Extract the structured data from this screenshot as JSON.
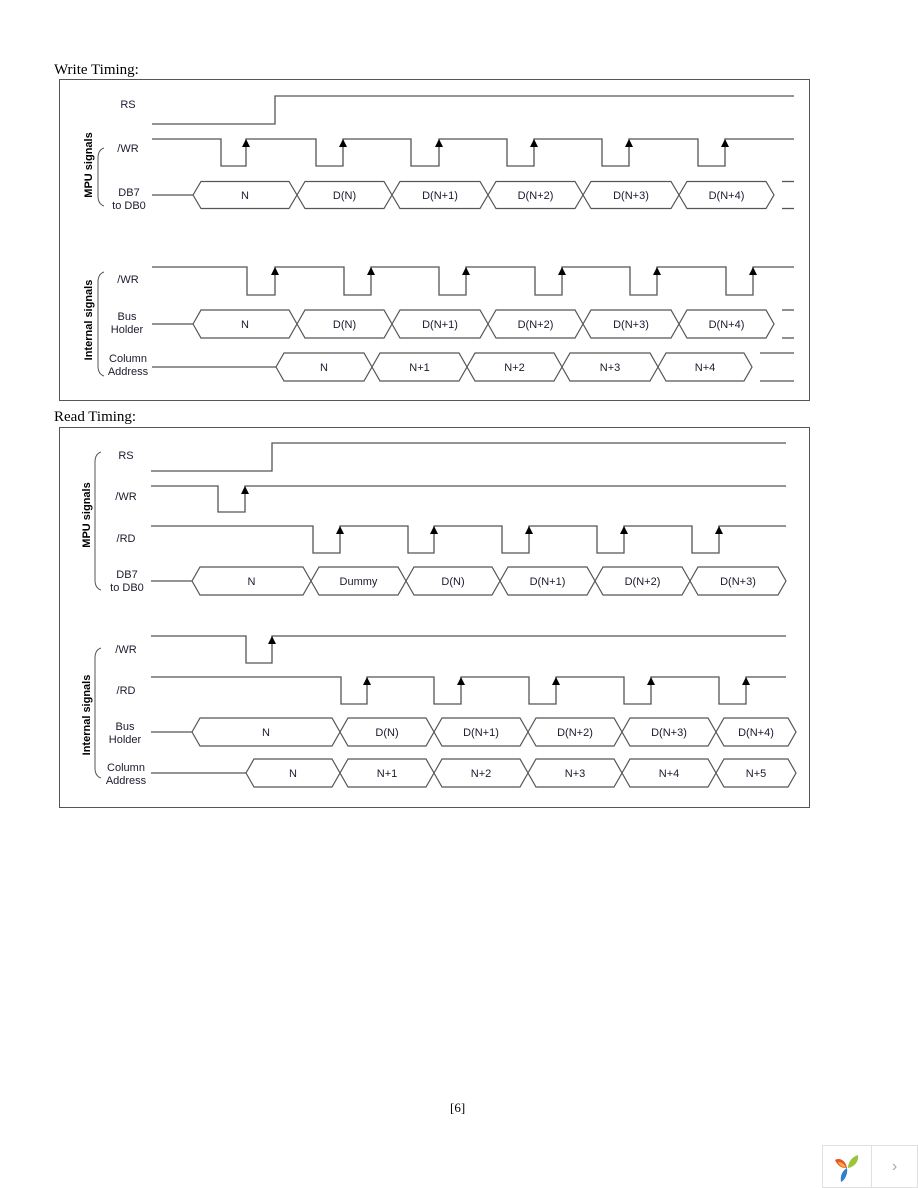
{
  "sections": {
    "write": {
      "title": "Write Timing:",
      "groups": [
        {
          "label": "MPU signals"
        },
        {
          "label": "Internal signals"
        }
      ],
      "signals": {
        "rs": {
          "label": "RS"
        },
        "wr": {
          "label": "/WR"
        },
        "db": {
          "label_line1": "DB7",
          "label_line2": "to DB0"
        },
        "int_wr": {
          "label": "/WR"
        },
        "bus": {
          "label_line1": "Bus",
          "label_line2": "Holder"
        },
        "col": {
          "label_line1": "Column",
          "label_line2": "Address"
        }
      },
      "db_values": [
        "N",
        "D(N)",
        "D(N+1)",
        "D(N+2)",
        "D(N+3)",
        "D(N+4)"
      ],
      "bus_values": [
        "N",
        "D(N)",
        "D(N+1)",
        "D(N+2)",
        "D(N+3)",
        "D(N+4)"
      ],
      "col_values": [
        "N",
        "N+1",
        "N+2",
        "N+3",
        "N+4"
      ]
    },
    "read": {
      "title": "Read Timing:",
      "groups": [
        {
          "label": "MPU signals"
        },
        {
          "label": "Internal signals"
        }
      ],
      "signals": {
        "rs": {
          "label": "RS"
        },
        "wr": {
          "label": "/WR"
        },
        "rd": {
          "label": "/RD"
        },
        "db": {
          "label_line1": "DB7",
          "label_line2": "to DB0"
        },
        "int_wr": {
          "label": "/WR"
        },
        "int_rd": {
          "label": "/RD"
        },
        "bus": {
          "label_line1": "Bus",
          "label_line2": "Holder"
        },
        "col": {
          "label_line1": "Column",
          "label_line2": "Address"
        }
      },
      "db_values": [
        "N",
        "Dummy",
        "D(N)",
        "D(N+1)",
        "D(N+2)",
        "D(N+3)"
      ],
      "bus_values": [
        "N",
        "D(N)",
        "D(N+1)",
        "D(N+2)",
        "D(N+3)",
        "D(N+4)"
      ],
      "col_values": [
        "N",
        "N+1",
        "N+2",
        "N+3",
        "N+4",
        "N+5"
      ]
    }
  },
  "footer": {
    "page_number": "[6]",
    "next_icon": "chevron-right-icon",
    "next_symbol": "›"
  }
}
